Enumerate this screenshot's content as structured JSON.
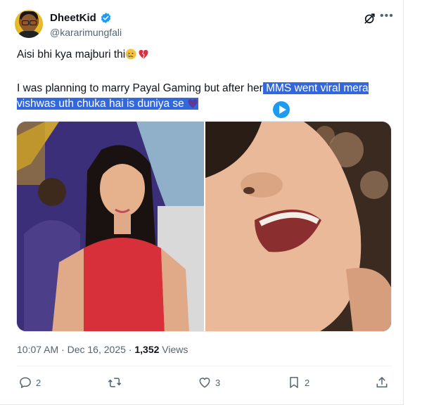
{
  "user": {
    "display_name": "DheetKid",
    "handle": "@kararimungfali",
    "verified": true,
    "avatar_icon": "avatar-icon"
  },
  "post": {
    "line1": "Aisi bhi kya majburi thi",
    "line2_plain": "I was planning to marry Payal Gaming but after her",
    "line2_highlight": " MMS went viral mera",
    "line3_highlight": "vishwas uth chuka hai is duniya se",
    "emojis": [
      "sad-face-emoji",
      "broken-heart-emoji",
      "broken-heart-emoji"
    ]
  },
  "meta": {
    "time": "10:07 AM",
    "sep": "·",
    "date": "Dec 16, 2025",
    "views_count": "1,352",
    "views_label": "Views"
  },
  "actions": {
    "replies": "2",
    "reposts": "",
    "likes": "3",
    "bookmarks": "2"
  },
  "colors": {
    "accent": "#1d9bf0",
    "highlight": "#3368dc",
    "muted": "#536471"
  }
}
